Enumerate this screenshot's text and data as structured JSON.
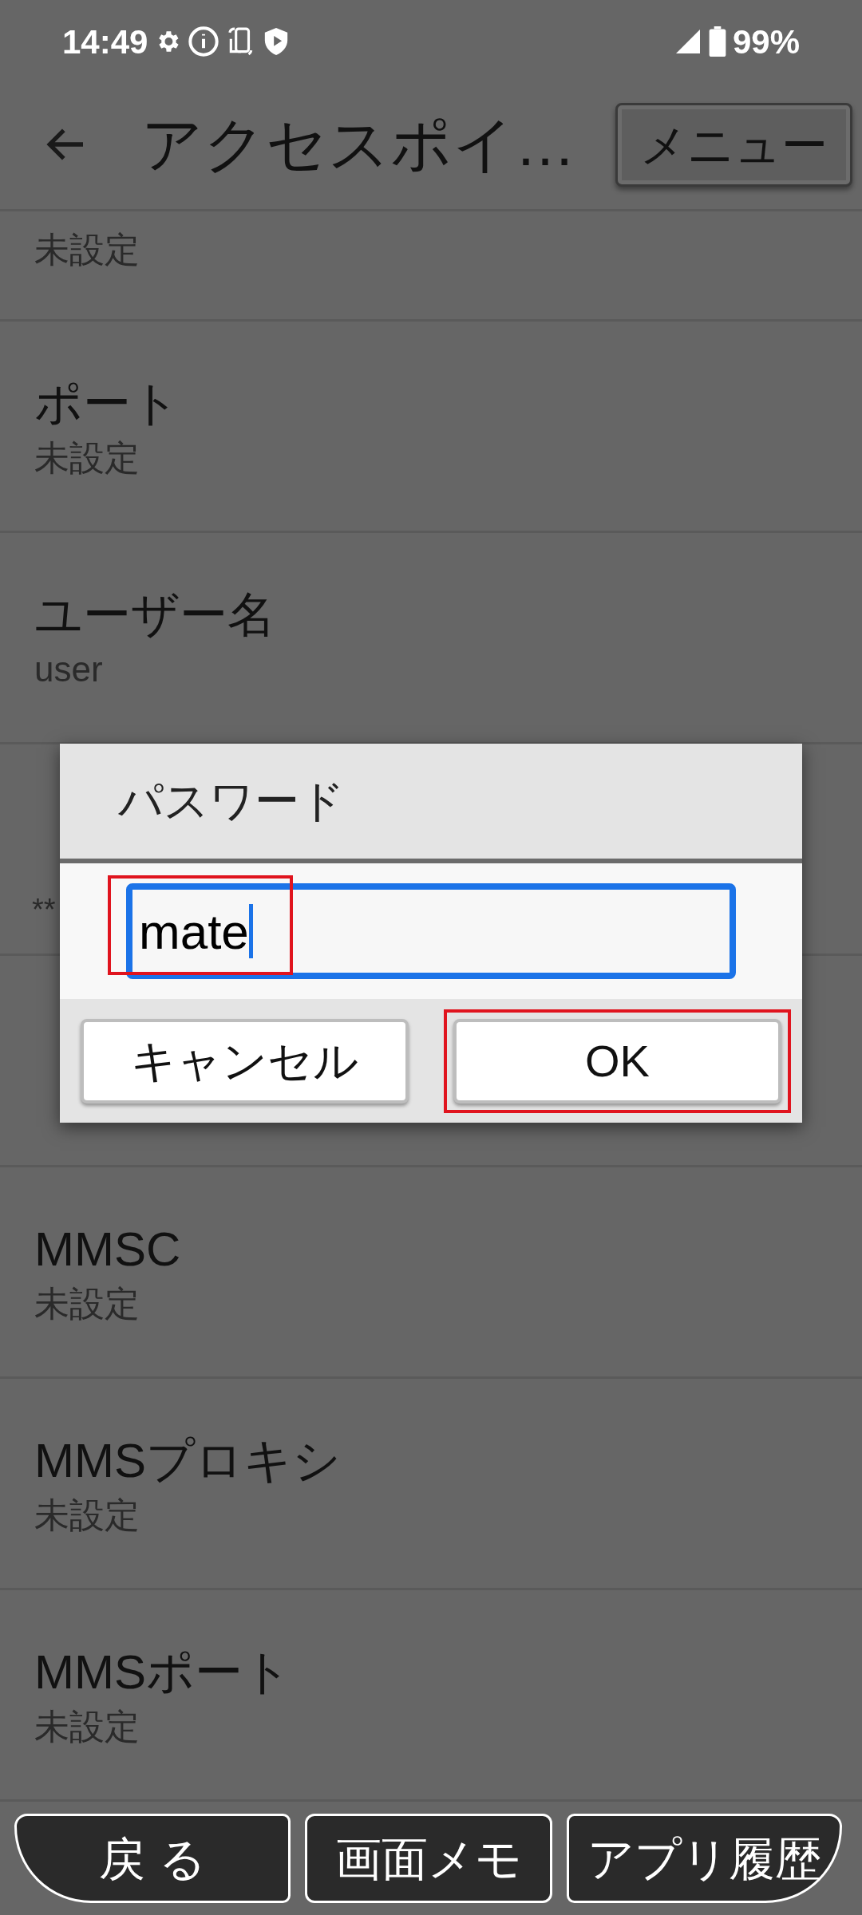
{
  "status_bar": {
    "time": "14:49",
    "battery": "99%"
  },
  "toolbar": {
    "title": "アクセスポイ…",
    "menu_button": "メニュー"
  },
  "settings": [
    {
      "value": "未設定"
    },
    {
      "title": "ポート",
      "value": "未設定"
    },
    {
      "title": "ユーザー名",
      "value": "user"
    },
    {
      "value": "**"
    },
    {
      "title": "MMSC",
      "value": "未設定"
    },
    {
      "title": "MMSプロキシ",
      "value": "未設定"
    },
    {
      "title": "MMSポート",
      "value": "未設定"
    }
  ],
  "dialog": {
    "title": "パスワード",
    "input_value": "mate",
    "buttons": [
      {
        "label": "キャンセル",
        "highlighted": false
      },
      {
        "label": "OK",
        "highlighted": true
      }
    ],
    "input_highlighted": true
  },
  "bottom_bar": [
    {
      "label": "戻 る",
      "kind": "left"
    },
    {
      "label": "画面メモ",
      "kind": "middle"
    },
    {
      "label": "アプリ履歴",
      "kind": "right"
    }
  ]
}
